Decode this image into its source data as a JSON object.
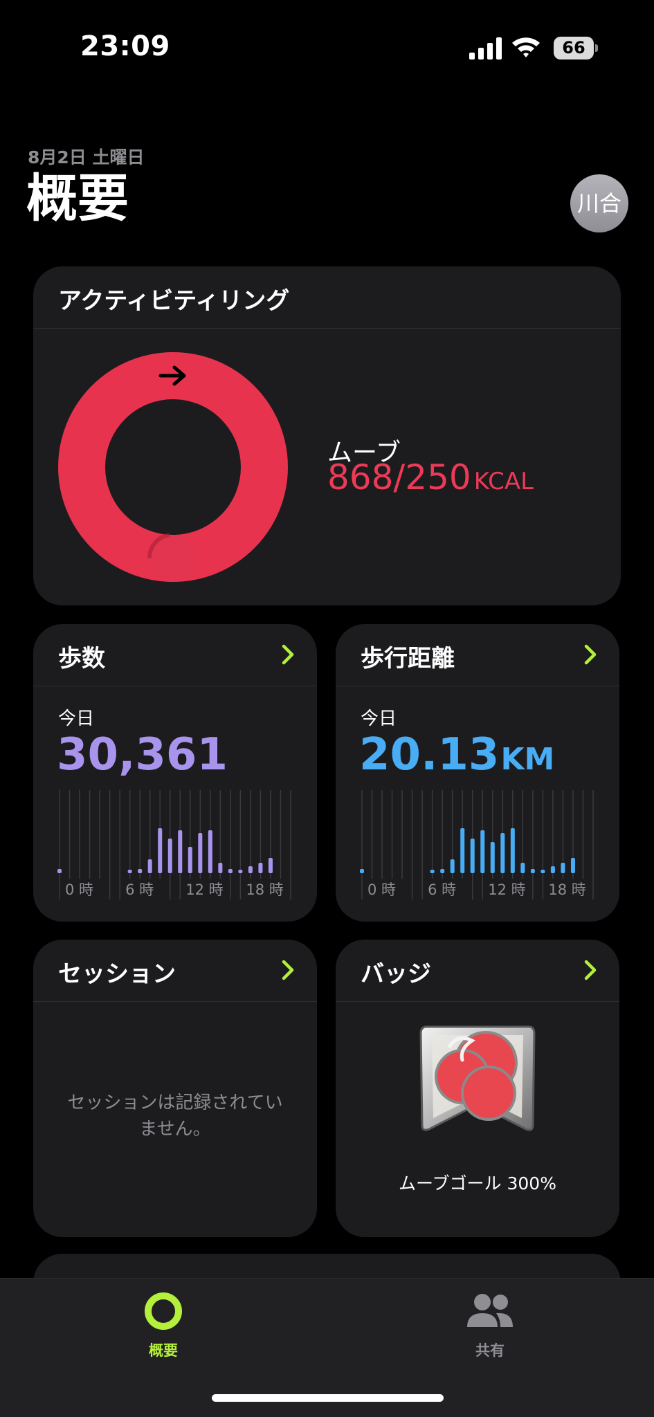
{
  "status_bar": {
    "time": "23:09",
    "battery": "66"
  },
  "header": {
    "date": "8月2日 土曜日",
    "title": "概要",
    "avatar_initials": "川合"
  },
  "activity_ring": {
    "title": "アクティビティリング",
    "move_label": "ムーブ",
    "move_value": "868/250",
    "move_unit": "KCAL",
    "move_progress": 3.47,
    "ring_color": "#e8334f"
  },
  "steps": {
    "title": "歩数",
    "today_label": "今日",
    "value": "30,361",
    "color": "#a894ec",
    "axis_labels": [
      "0 時",
      "6 時",
      "12 時",
      "18 時"
    ],
    "hourly": [
      0.06,
      0,
      0,
      0,
      0,
      0,
      0,
      0.05,
      0.06,
      0.2,
      0.65,
      0.5,
      0.62,
      0.38,
      0.58,
      0.62,
      0.15,
      0.06,
      0.05,
      0.1,
      0.15,
      0.22
    ]
  },
  "distance": {
    "title": "歩行距離",
    "today_label": "今日",
    "value": "20.13",
    "unit": "KM",
    "color": "#49adf5",
    "axis_labels": [
      "0 時",
      "6 時",
      "12 時",
      "18 時"
    ],
    "hourly": [
      0.06,
      0,
      0,
      0,
      0,
      0,
      0,
      0.05,
      0.06,
      0.2,
      0.65,
      0.5,
      0.62,
      0.45,
      0.58,
      0.65,
      0.15,
      0.06,
      0.05,
      0.1,
      0.15,
      0.22
    ]
  },
  "sessions": {
    "title": "セッション",
    "empty_text": "セッションは記録されていません。"
  },
  "badges": {
    "title": "バッジ",
    "badge_name": "ムーブゴール 300%"
  },
  "tab_bar": {
    "summary_label": "概要",
    "sharing_label": "共有",
    "active_color": "#b4f03b"
  },
  "accent_chevron_color": "#b4f03b"
}
